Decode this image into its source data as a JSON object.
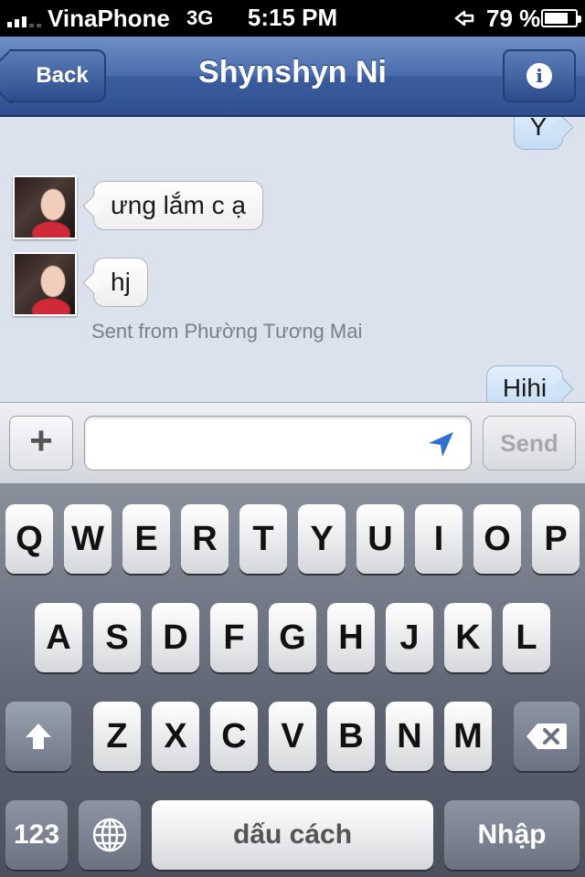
{
  "status_bar": {
    "carrier": "VinaPhone",
    "network": "3G",
    "time": "5:15 PM",
    "battery_percent": "79 %",
    "battery_level": 0.79,
    "signal_icon": "signal-bars-icon",
    "location_icon": "location-services-arrow-icon",
    "battery_icon": "battery-charging-icon"
  },
  "nav": {
    "back_label": "Back",
    "title": "Shynshyn Ni",
    "info_icon": "info-icon",
    "info_glyph": "i"
  },
  "chat": {
    "messages": [
      {
        "direction": "outgoing",
        "text": "Y"
      },
      {
        "direction": "incoming",
        "text": "ưng lắm c ạ"
      },
      {
        "direction": "incoming",
        "text": "hj"
      },
      {
        "direction": "outgoing",
        "text": "Hihi"
      }
    ],
    "location_note": "Sent from Phường Tương Mai"
  },
  "input_bar": {
    "plus_glyph": "+",
    "message_value": "",
    "message_placeholder": "",
    "send_label": "Send",
    "location_icon": "location-arrow-icon"
  },
  "keyboard": {
    "row1": [
      "Q",
      "W",
      "E",
      "R",
      "T",
      "Y",
      "U",
      "I",
      "O",
      "P"
    ],
    "row2": [
      "A",
      "S",
      "D",
      "F",
      "G",
      "H",
      "J",
      "K",
      "L"
    ],
    "row3": [
      "Z",
      "X",
      "C",
      "V",
      "B",
      "N",
      "M"
    ],
    "numbers_label": "123",
    "space_label": "dấu cách",
    "return_label": "Nhập",
    "shift_icon": "shift-icon",
    "delete_icon": "delete-icon",
    "globe_icon": "globe-icon"
  },
  "colors": {
    "nav_blue": "#3b5d9f",
    "chat_background": "#dbe2ed",
    "outgoing_bubble": "#c3dcf5",
    "incoming_bubble": "#ffffff"
  }
}
